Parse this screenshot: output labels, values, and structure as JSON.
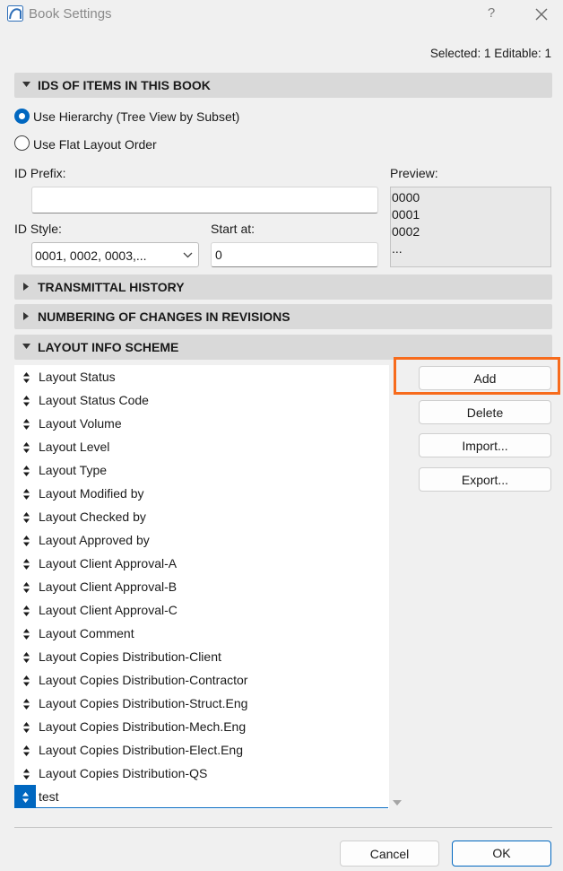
{
  "window": {
    "title": "Book Settings",
    "help": "?"
  },
  "selection_info": "Selected: 1 Editable: 1",
  "sections": {
    "ids": "IDS OF ITEMS IN THIS BOOK",
    "transmittal": "TRANSMITTAL HISTORY",
    "numbering": "NUMBERING OF CHANGES IN REVISIONS",
    "layout_info": "LAYOUT INFO SCHEME"
  },
  "ids_options": {
    "hierarchy": "Use Hierarchy (Tree View by Subset)",
    "flat": "Use Flat Layout Order",
    "selected": "hierarchy"
  },
  "id_prefix": {
    "label": "ID Prefix:",
    "value": ""
  },
  "id_style": {
    "label": "ID Style:",
    "value": "0001, 0002, 0003,..."
  },
  "start_at": {
    "label": "Start at:",
    "value": "0"
  },
  "preview": {
    "label": "Preview:",
    "lines": [
      "0000",
      "0001",
      "0002",
      "..."
    ]
  },
  "layout_items": [
    "Layout Status",
    "Layout Status Code",
    "Layout Volume",
    "Layout Level",
    "Layout Type",
    "Layout Modified by",
    "Layout Checked by",
    "Layout Approved by",
    "Layout Client Approval-A",
    "Layout Client Approval-B",
    "Layout Client Approval-C",
    "Layout Comment",
    "Layout Copies Distribution-Client",
    "Layout Copies Distribution-Contractor",
    "Layout Copies Distribution-Struct.Eng",
    "Layout Copies Distribution-Mech.Eng",
    "Layout Copies Distribution-Elect.Eng",
    "Layout Copies Distribution-QS"
  ],
  "editing_item": "test",
  "side_buttons": {
    "add": "Add",
    "delete": "Delete",
    "import": "Import...",
    "export": "Export..."
  },
  "footer": {
    "cancel": "Cancel",
    "ok": "OK"
  },
  "colors": {
    "accent": "#0067c0",
    "highlight": "#f76b1c",
    "section_bg": "#d9d9d9"
  }
}
